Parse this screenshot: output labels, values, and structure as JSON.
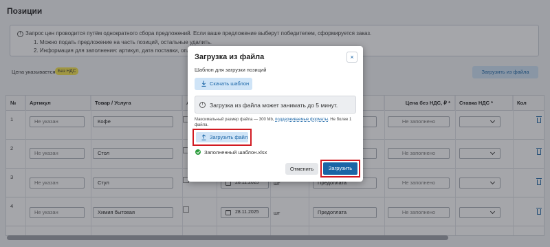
{
  "page": {
    "title": "Позиции",
    "info_lines": [
      "Запрос цен проводится путём однократного сбора предложений. Если ваше предложение выберут победителем, сформируется заказ.",
      "1. Можно подать предложение на часть позиций, остальные удалить.",
      "2. Информация для заполнения: артикул, дата поставки, опл"
    ],
    "price_label": "Цена указывается",
    "vat_badge": "Без НДС",
    "upload_top_label": "Загрузить из файла"
  },
  "table": {
    "headers": {
      "num": "№",
      "article": "Артикул",
      "product": "Товар / Услуга",
      "analog": "Ан",
      "price": "Цена без НДС, ₽ *",
      "vat": "Ставка НДС *",
      "qty": "Кол"
    },
    "rows": [
      {
        "num": "1",
        "article": "Не указан",
        "product": "Кофе",
        "date": "",
        "unit": "",
        "payment": "",
        "price": "Не заполнено"
      },
      {
        "num": "2",
        "article": "Не указан",
        "product": "Стол",
        "date": "",
        "unit": "",
        "payment": "",
        "price": "Не заполнено"
      },
      {
        "num": "3",
        "article": "Не указан",
        "product": "Стул",
        "date": "28.11.2025",
        "unit": "шт",
        "payment": "Предоплата",
        "price": "Не заполнено"
      },
      {
        "num": "4",
        "article": "Не указан",
        "product": "Химия бытовая",
        "date": "28.11.2025",
        "unit": "шт",
        "payment": "Предоплата",
        "price": "Не заполнено"
      }
    ]
  },
  "modal": {
    "title": "Загрузка из файла",
    "close_glyph": "×",
    "template_label": "Шаблон для загрузки позиций",
    "download_label": "Скачать шаблон",
    "notice_glyph": "!",
    "notice": "Загрузка из файла может занимать до 5 минут.",
    "size_note_prefix": "Максимальный размер файла — 300 Mb,",
    "size_note_link": "поддерживаемые форматы.",
    "size_note_suffix": "Не более 1 файла.",
    "upload_label": "Загрузить файл",
    "file_name": "Заполненный шаблон.xlsx",
    "cancel_label": "Отменить",
    "submit_label": "Загрузить"
  },
  "colors": {
    "accent": "#1a65a6",
    "highlight": "#d11a22",
    "success": "#2e9d3e",
    "badge": "#f5e44c"
  }
}
